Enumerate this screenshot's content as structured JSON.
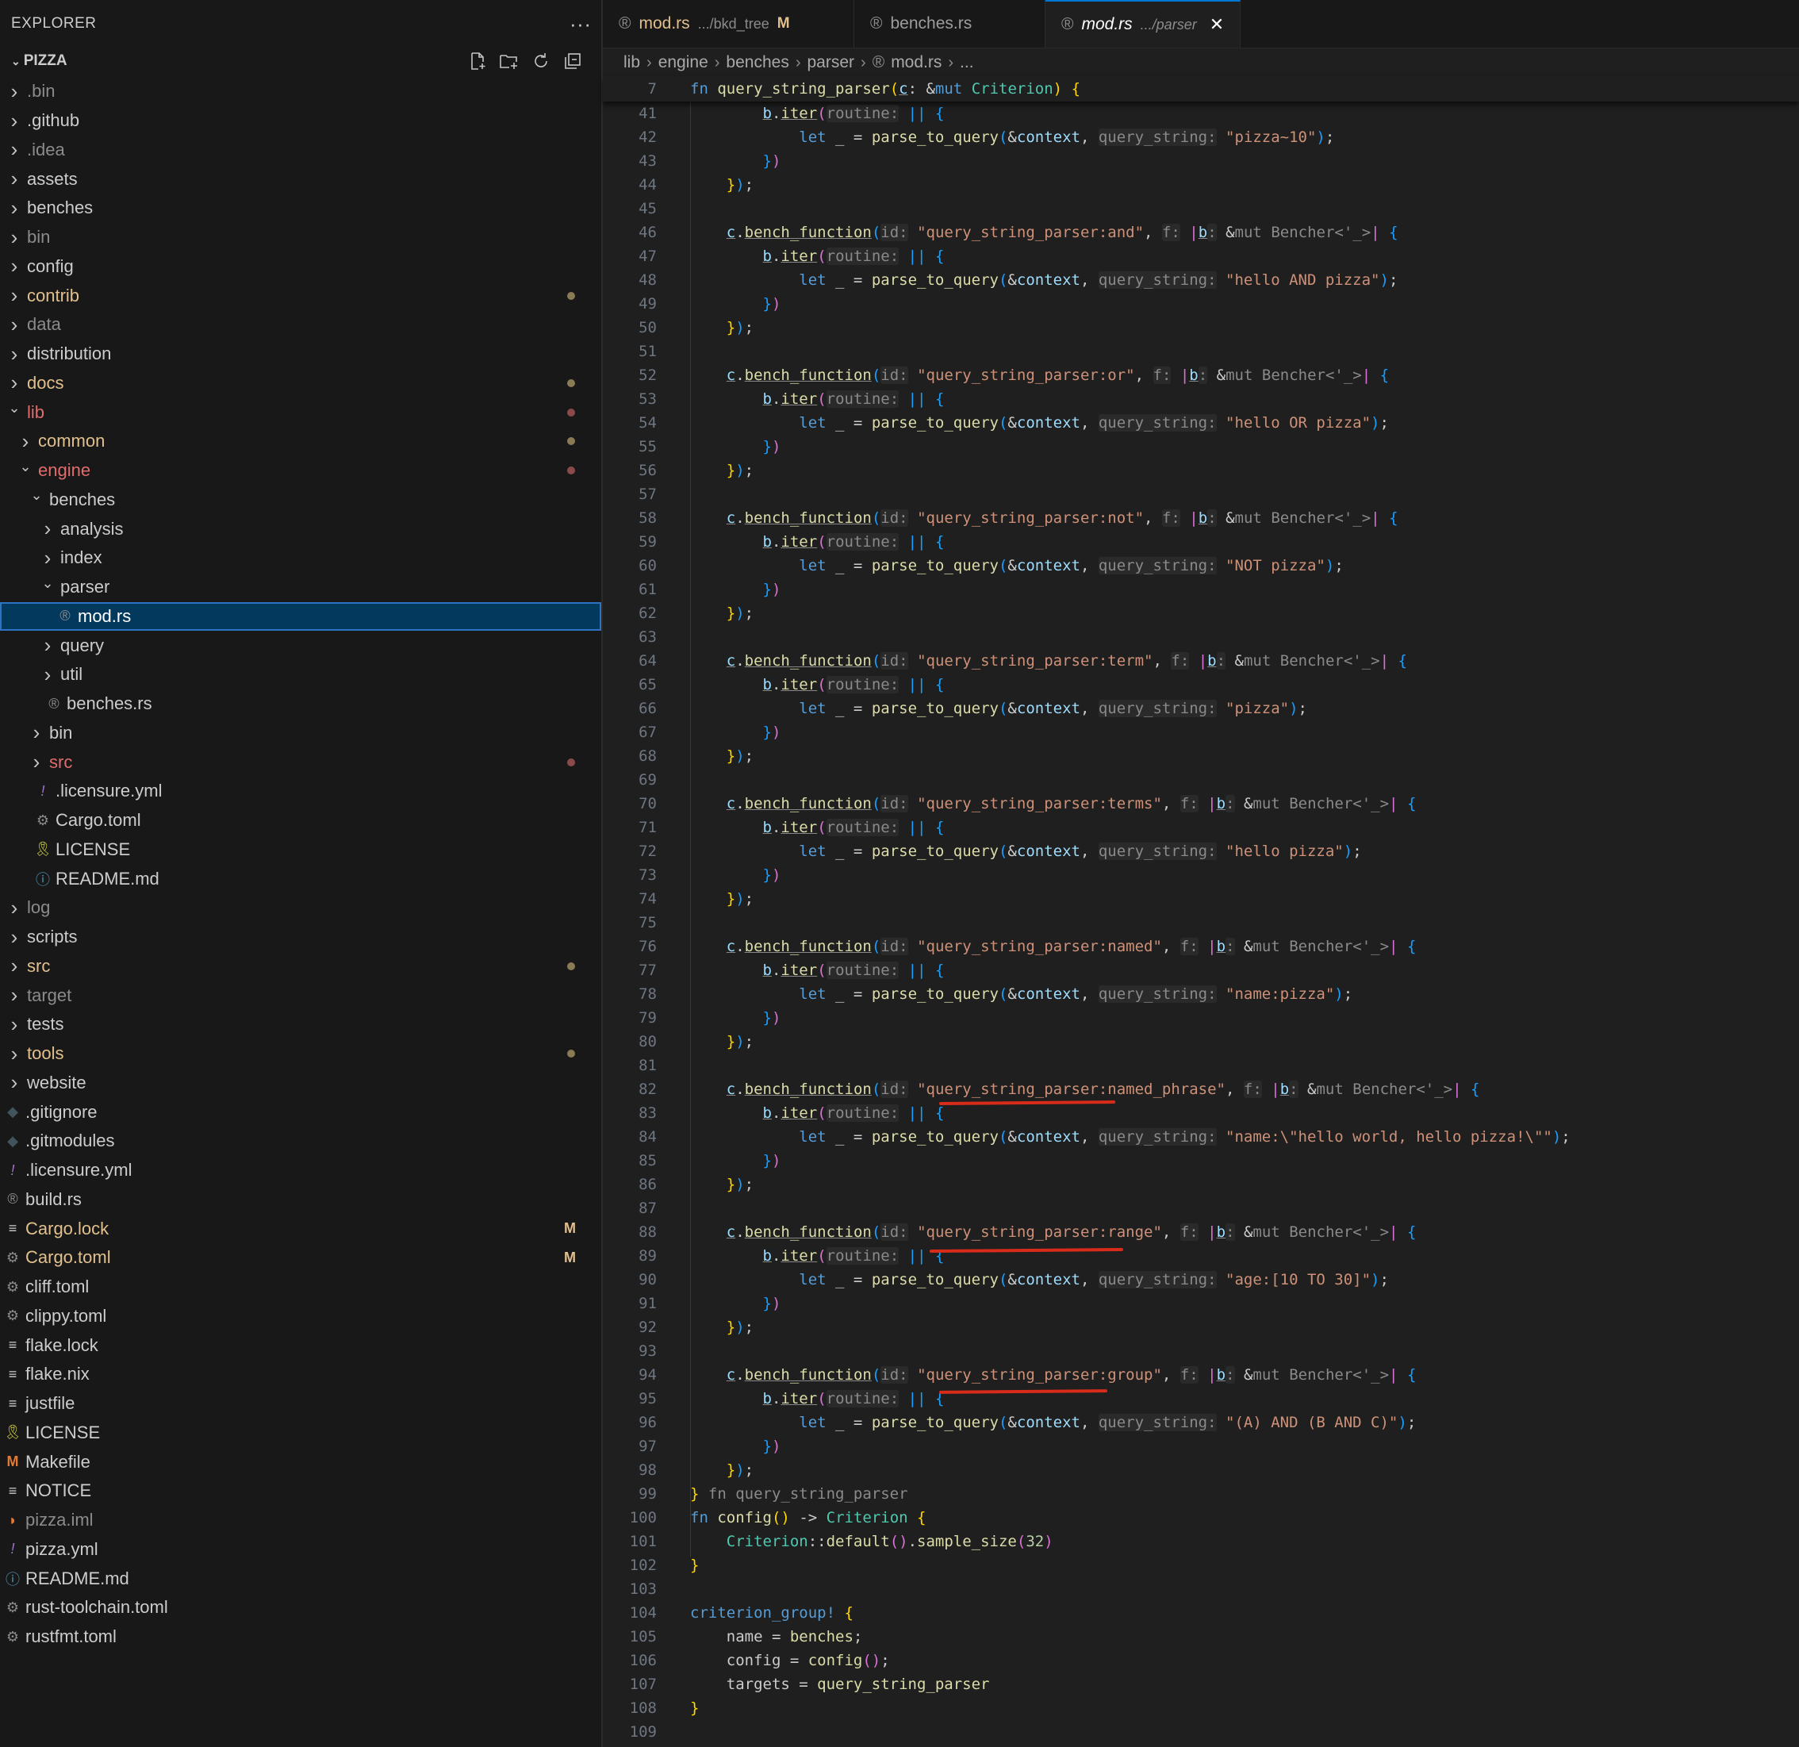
{
  "sidebar": {
    "title": "EXPLORER",
    "more": "···",
    "project": "PIZZA",
    "actions": [
      "new-file-icon",
      "new-folder-icon",
      "refresh-icon",
      "collapse-icon"
    ],
    "items": [
      {
        "label": ".bin",
        "level": 0,
        "type": "folder",
        "open": false,
        "color": "#8b8b8b"
      },
      {
        "label": ".github",
        "level": 0,
        "type": "folder",
        "open": false,
        "color": "#cccccc"
      },
      {
        "label": ".idea",
        "level": 0,
        "type": "folder",
        "open": false,
        "color": "#8b8b8b"
      },
      {
        "label": "assets",
        "level": 0,
        "type": "folder",
        "open": false,
        "color": "#cccccc"
      },
      {
        "label": "benches",
        "level": 0,
        "type": "folder",
        "open": false,
        "color": "#cccccc"
      },
      {
        "label": "bin",
        "level": 0,
        "type": "folder",
        "open": false,
        "color": "#8b8b8b"
      },
      {
        "label": "config",
        "level": 0,
        "type": "folder",
        "open": false,
        "color": "#cccccc"
      },
      {
        "label": "contrib",
        "level": 0,
        "type": "folder",
        "open": false,
        "color": "#e2c08d",
        "dot": "#8a7a55"
      },
      {
        "label": "data",
        "level": 0,
        "type": "folder",
        "open": false,
        "color": "#8b8b8b"
      },
      {
        "label": "distribution",
        "level": 0,
        "type": "folder",
        "open": false,
        "color": "#cccccc"
      },
      {
        "label": "docs",
        "level": 0,
        "type": "folder",
        "open": false,
        "color": "#e2c08d",
        "dot": "#8a7a55"
      },
      {
        "label": "lib",
        "level": 0,
        "type": "folder",
        "open": true,
        "color": "#e06c6c",
        "dot": "#8a4a4a"
      },
      {
        "label": "common",
        "level": 1,
        "type": "folder",
        "open": false,
        "color": "#e2c08d",
        "dot": "#8a7a55"
      },
      {
        "label": "engine",
        "level": 1,
        "type": "folder",
        "open": true,
        "color": "#e06c6c",
        "dot": "#8a4a4a"
      },
      {
        "label": "benches",
        "level": 2,
        "type": "folder",
        "open": true,
        "color": "#cccccc"
      },
      {
        "label": "analysis",
        "level": 3,
        "type": "folder",
        "open": false,
        "color": "#cccccc"
      },
      {
        "label": "index",
        "level": 3,
        "type": "folder",
        "open": false,
        "color": "#cccccc"
      },
      {
        "label": "parser",
        "level": 3,
        "type": "folder",
        "open": true,
        "color": "#cccccc"
      },
      {
        "label": "mod.rs",
        "level": 4,
        "type": "file",
        "icon": "rust-icon",
        "glyph": "®",
        "iconColor": "#8b8b8b",
        "color": "#ffffff",
        "selected": true
      },
      {
        "label": "query",
        "level": 3,
        "type": "folder",
        "open": false,
        "color": "#cccccc"
      },
      {
        "label": "util",
        "level": 3,
        "type": "folder",
        "open": false,
        "color": "#cccccc"
      },
      {
        "label": "benches.rs",
        "level": 3,
        "type": "file",
        "icon": "rust-icon",
        "glyph": "®",
        "iconColor": "#8b8b8b",
        "color": "#cccccc"
      },
      {
        "label": "bin",
        "level": 2,
        "type": "folder",
        "open": false,
        "color": "#cccccc"
      },
      {
        "label": "src",
        "level": 2,
        "type": "folder",
        "open": false,
        "color": "#e06c6c",
        "dot": "#8a4a4a"
      },
      {
        "label": ".licensure.yml",
        "level": 2,
        "type": "file",
        "icon": "exclamation-icon",
        "glyph": "!",
        "iconColor": "#a074c4",
        "color": "#cccccc"
      },
      {
        "label": "Cargo.toml",
        "level": 2,
        "type": "file",
        "icon": "gear-icon",
        "glyph": "⚙",
        "iconColor": "#8b8b8b",
        "color": "#cccccc"
      },
      {
        "label": "LICENSE",
        "level": 2,
        "type": "file",
        "icon": "license-icon",
        "glyph": "🎗",
        "iconColor": "#cbcb41",
        "color": "#cccccc"
      },
      {
        "label": "README.md",
        "level": 2,
        "type": "file",
        "icon": "info-icon",
        "glyph": "ⓘ",
        "iconColor": "#519aba",
        "color": "#cccccc"
      },
      {
        "label": "log",
        "level": 0,
        "type": "folder",
        "open": false,
        "color": "#8b8b8b"
      },
      {
        "label": "scripts",
        "level": 0,
        "type": "folder",
        "open": false,
        "color": "#cccccc"
      },
      {
        "label": "src",
        "level": 0,
        "type": "folder",
        "open": false,
        "color": "#e2c08d",
        "dot": "#8a7a55"
      },
      {
        "label": "target",
        "level": 0,
        "type": "folder",
        "open": false,
        "color": "#8b8b8b"
      },
      {
        "label": "tests",
        "level": 0,
        "type": "folder",
        "open": false,
        "color": "#cccccc"
      },
      {
        "label": "tools",
        "level": 0,
        "type": "folder",
        "open": false,
        "color": "#e2c08d",
        "dot": "#8a7a55"
      },
      {
        "label": "website",
        "level": 0,
        "type": "folder",
        "open": false,
        "color": "#cccccc"
      },
      {
        "label": ".gitignore",
        "level": -1,
        "type": "file",
        "icon": "git-icon",
        "glyph": "◆",
        "iconColor": "#41535b",
        "color": "#cccccc"
      },
      {
        "label": ".gitmodules",
        "level": -1,
        "type": "file",
        "icon": "git-icon",
        "glyph": "◆",
        "iconColor": "#41535b",
        "color": "#cccccc"
      },
      {
        "label": ".licensure.yml",
        "level": -1,
        "type": "file",
        "icon": "exclamation-icon",
        "glyph": "!",
        "iconColor": "#a074c4",
        "color": "#cccccc"
      },
      {
        "label": "build.rs",
        "level": -1,
        "type": "file",
        "icon": "rust-icon",
        "glyph": "®",
        "iconColor": "#8b8b8b",
        "color": "#cccccc"
      },
      {
        "label": "Cargo.lock",
        "level": -1,
        "type": "file",
        "icon": "lines-icon",
        "glyph": "≡",
        "iconColor": "#cccccc",
        "color": "#e2c08d",
        "deco": "M"
      },
      {
        "label": "Cargo.toml",
        "level": -1,
        "type": "file",
        "icon": "gear-icon",
        "glyph": "⚙",
        "iconColor": "#8b8b8b",
        "color": "#e2c08d",
        "deco": "M"
      },
      {
        "label": "cliff.toml",
        "level": -1,
        "type": "file",
        "icon": "gear-icon",
        "glyph": "⚙",
        "iconColor": "#8b8b8b",
        "color": "#cccccc"
      },
      {
        "label": "clippy.toml",
        "level": -1,
        "type": "file",
        "icon": "gear-icon",
        "glyph": "⚙",
        "iconColor": "#8b8b8b",
        "color": "#cccccc"
      },
      {
        "label": "flake.lock",
        "level": -1,
        "type": "file",
        "icon": "lines-icon",
        "glyph": "≡",
        "iconColor": "#cccccc",
        "color": "#cccccc"
      },
      {
        "label": "flake.nix",
        "level": -1,
        "type": "file",
        "icon": "lines-icon",
        "glyph": "≡",
        "iconColor": "#cccccc",
        "color": "#cccccc"
      },
      {
        "label": "justfile",
        "level": -1,
        "type": "file",
        "icon": "lines-icon",
        "glyph": "≡",
        "iconColor": "#cccccc",
        "color": "#cccccc"
      },
      {
        "label": "LICENSE",
        "level": -1,
        "type": "file",
        "icon": "license-icon",
        "glyph": "🎗",
        "iconColor": "#cbcb41",
        "color": "#cccccc"
      },
      {
        "label": "Makefile",
        "level": -1,
        "type": "file",
        "icon": "makefile-icon",
        "glyph": "M",
        "iconColor": "#e37933",
        "color": "#cccccc"
      },
      {
        "label": "NOTICE",
        "level": -1,
        "type": "file",
        "icon": "lines-icon",
        "glyph": "≡",
        "iconColor": "#cccccc",
        "color": "#cccccc"
      },
      {
        "label": "pizza.iml",
        "level": -1,
        "type": "file",
        "icon": "rss-icon",
        "glyph": "◗",
        "iconColor": "#e37933",
        "color": "#8b8b8b"
      },
      {
        "label": "pizza.yml",
        "level": -1,
        "type": "file",
        "icon": "exclamation-icon",
        "glyph": "!",
        "iconColor": "#a074c4",
        "color": "#cccccc"
      },
      {
        "label": "README.md",
        "level": -1,
        "type": "file",
        "icon": "info-icon",
        "glyph": "ⓘ",
        "iconColor": "#519aba",
        "color": "#cccccc"
      },
      {
        "label": "rust-toolchain.toml",
        "level": -1,
        "type": "file",
        "icon": "gear-icon",
        "glyph": "⚙",
        "iconColor": "#8b8b8b",
        "color": "#cccccc"
      },
      {
        "label": "rustfmt.toml",
        "level": -1,
        "type": "file",
        "icon": "gear-icon",
        "glyph": "⚙",
        "iconColor": "#8b8b8b",
        "color": "#cccccc"
      }
    ]
  },
  "tabs": [
    {
      "name": "mod.rs",
      "path": ".../bkd_tree",
      "badge": "M",
      "active": false
    },
    {
      "name": "benches.rs",
      "path": "",
      "badge": "",
      "active": false
    },
    {
      "name": "mod.rs",
      "path": ".../parser",
      "badge": "",
      "active": true,
      "close": "✕"
    }
  ],
  "breadcrumbs": [
    "lib",
    "engine",
    "benches",
    "parser",
    "mod.rs",
    "..."
  ],
  "editor": {
    "sticky": {
      "num": "7",
      "html": "<span class='kw'>fn</span> <span class='fn'>query_string_parser</span><span class='p1'>(</span><span class='var u'>c</span>: &amp;<span class='kw'>mut</span> <span class='ty'>Criterion</span><span class='p1'>)</span> <span class='p1'>{</span>"
    },
    "blocks": [
      {
        "start": 46,
        "id": "query_string_parser:and",
        "q": "hello AND pizza"
      },
      {
        "start": 52,
        "id": "query_string_parser:or",
        "q": "hello OR pizza"
      },
      {
        "start": 58,
        "id": "query_string_parser:not",
        "q": "NOT pizza"
      },
      {
        "start": 64,
        "id": "query_string_parser:term",
        "q": "pizza"
      },
      {
        "start": 70,
        "id": "query_string_parser:terms",
        "q": "hello pizza"
      },
      {
        "start": 76,
        "id": "query_string_parser:named",
        "q": "name:pizza"
      },
      {
        "start": 82,
        "id": "query_string_parser:named_phrase",
        "q": "name:\\\"hello world, hello pizza!\\\""
      },
      {
        "start": 88,
        "id": "query_string_parser:range",
        "q": "age:[10 TO 30]"
      },
      {
        "start": 94,
        "id": "query_string_parser:group",
        "q": "(A) AND (B AND C)"
      }
    ],
    "first_block_query": "pizza~10",
    "hints": {
      "id": "id:",
      "f": "f:",
      "b": "b:",
      "routine": "routine:",
      "query_string": "query_string:"
    },
    "tail": [
      {
        "num": "99",
        "html": "<span class='p1'>}</span> <span style='color:#8a8a8a'>fn query_string_parser</span>"
      },
      {
        "num": "100",
        "html": "<span class='kw'>fn</span> <span class='fn'>config</span><span class='p1'>()</span> -&gt; <span class='ty'>Criterion</span> <span class='p1'>{</span>"
      },
      {
        "num": "101",
        "html": "    <span class='ty'>Criterion</span>::<span class='fn'>default</span><span class='p2'>()</span>.<span class='fn'>sample_size</span><span class='p2'>(</span><span class='num'>32</span><span class='p2'>)</span>"
      },
      {
        "num": "102",
        "html": "<span class='p1'>}</span>"
      },
      {
        "num": "103",
        "html": ""
      },
      {
        "num": "104",
        "html": "<span class='mac'>criterion_group!</span> <span class='p1'>{</span>"
      },
      {
        "num": "105",
        "html": "    name = <span class='fn'>benches</span>;"
      },
      {
        "num": "106",
        "html": "    config = <span class='fn'>config</span><span class='p2'>()</span>;"
      },
      {
        "num": "107",
        "html": "    targets = <span class='fn'>query_string_parser</span>"
      },
      {
        "num": "108",
        "html": "<span class='p1'>}</span>"
      },
      {
        "num": "109",
        "html": ""
      }
    ]
  }
}
